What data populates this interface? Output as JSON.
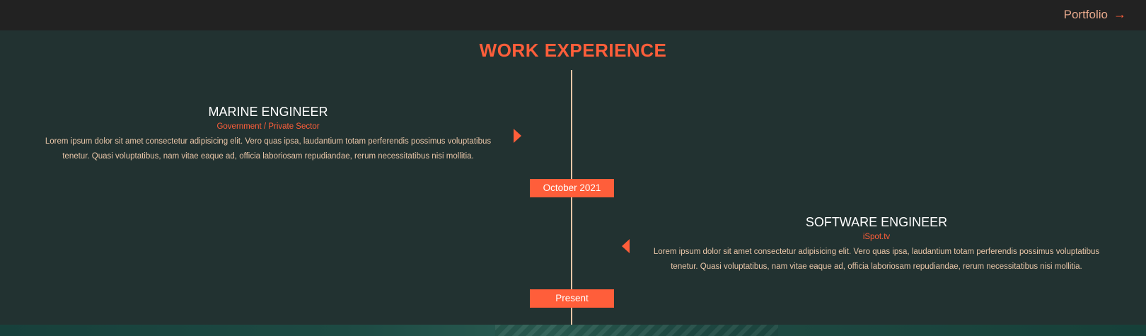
{
  "nav": {
    "portfolio_label": "Portfolio",
    "portfolio_icon": "arrow-right-icon",
    "portfolio_arrow": "→"
  },
  "section": {
    "title": "WORK EXPERIENCE"
  },
  "timeline": [
    {
      "title": "MARINE ENGINEER",
      "company": "Government / Private Sector",
      "description_line1": "Lorem ipsum dolor sit amet consectetur adipisicing elit. Vero quas ipsa, laudantium totam perferendis possimus voluptatibus",
      "description_line2": "tenetur. Quasi voluptatibus, nam vitae eaque ad, officia laboriosam repudiandae, rerum necessitatibus nisi mollitia.",
      "date": "October 2021"
    },
    {
      "title": "SOFTWARE ENGINEER",
      "company": "iSpot.tv",
      "description_line1": "Lorem ipsum dolor sit amet consectetur adipisicing elit. Vero quas ipsa, laudantium totam perferendis possimus voluptatibus",
      "description_line2": "tenetur. Quasi voluptatibus, nam vitae eaque ad, officia laboriosam repudiandae, rerum necessitatibus nisi mollitia.",
      "date": "Present"
    }
  ],
  "colors": {
    "accent": "#ff5e3a",
    "background": "#223231",
    "navbar": "#222222",
    "body_text": "#e9c6a8"
  }
}
